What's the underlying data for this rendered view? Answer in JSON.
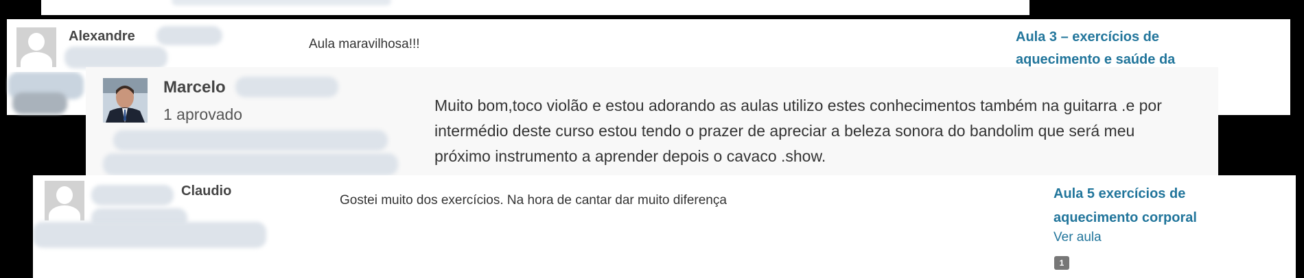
{
  "comments": [
    {
      "author": "Alexandre",
      "text": "Aula maravilhosa!!!",
      "post_title": "Aula 3 – exercícios de aquecimento e saúde da"
    },
    {
      "author": "Marcelo",
      "approved": "1 aprovado",
      "text": "Muito bom,toco violão e estou adorando as aulas utilizo estes conhecimentos também na guitarra .e por intermédio deste curso estou tendo o prazer de apreciar a beleza sonora do bandolim que será meu próximo instrumento a aprender depois o cavaco .show."
    },
    {
      "author": "Claudio",
      "text": "Gostei muito dos exercícios. Na hora de cantar dar muito diferença",
      "post_title": "Aula 5 exercícios de aquecimento corporal",
      "view_link": "Ver aula",
      "count": "1"
    }
  ],
  "colors": {
    "link": "#21759b",
    "author": "#444444",
    "avatar": "#d2d2d2"
  }
}
